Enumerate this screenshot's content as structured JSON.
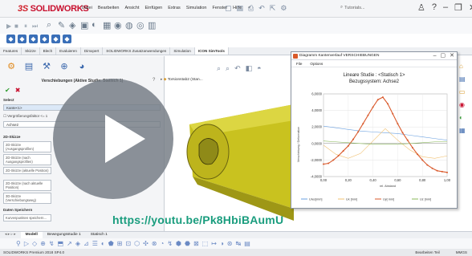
{
  "app": {
    "logo_ds": "3S",
    "logo_text": "SOLIDWORKS",
    "menus": [
      "Datei",
      "Bearbeiten",
      "Ansicht",
      "Einfügen",
      "Extras",
      "Simulation",
      "Fenster",
      "Hilfe"
    ],
    "search_label": "Tutorials...",
    "help_label": "?"
  },
  "tabs": [
    "Features",
    "Skizze",
    "Blech",
    "Evaluieren",
    "Dimxpert",
    "SOLIDWORKS Zusatzanwendungen",
    "Simulation",
    "ICON SimTools"
  ],
  "active_tab_index": 7,
  "panel": {
    "title": "Verschiebungen (Aktive Studie: Statisch 1)",
    "help": "?",
    "select_label": "Select",
    "select_value": "Kante<1>",
    "compare_label": "Vergrößerungsfaktor <= 1",
    "compare_value": "Achse2",
    "sketch_label": "2D-Skizze",
    "btn_1": "2D-Skizze (Ausgangsprofilen)",
    "btn_2": "2D-Skizze (nach Ausgangsprofilen)",
    "btn_3": "2D-Skizze (aktuelle Position)",
    "btn_4": "2D-Skizze (nach aktuelle Position)",
    "btn_5": "3D-Skizze (Verschiebungsweg)",
    "data_label": "Daten Speichern",
    "btn_6": "Kurvenpunkten speichern..."
  },
  "tree": {
    "label": "Torsionstab2 (Stan..."
  },
  "diagram": {
    "window_title": "Diagramm Kantenverlauf VERSCHIEBUNGEN",
    "menu_file": "File",
    "menu_options": "Options",
    "chart_title": "Lineare Studie : <Statisch 1>",
    "chart_subtitle": "Bezugssystem: Achse2",
    "ylabel": "Verschiebung / Deformation",
    "xlabel": "rel. Abstand",
    "legend": [
      "Ures[mm]",
      "Ux [mm]",
      "Uy[ mm]",
      "Uz [mm]"
    ]
  },
  "chart_data": {
    "type": "line",
    "title": "Lineare Studie : <Statisch 1>",
    "subtitle": "Bezugssystem: Achse2",
    "xlabel": "rel. Abstand",
    "ylabel": "Verschiebung / Deformation",
    "xlim": [
      0,
      1
    ],
    "ylim": [
      -4,
      6
    ],
    "xticks": [
      "0,00",
      "0,20",
      "0,40",
      "0,60",
      "0,80",
      "1,00"
    ],
    "yticks": [
      "-4,0000",
      "-2,0000",
      "0,0000",
      "2,0000",
      "4,0000",
      "6,0000"
    ],
    "grid": true,
    "legend_position": "bottom",
    "series": [
      {
        "name": "Ures[mm]",
        "color": "#6aa0e0",
        "x": [
          0,
          0.1,
          0.2,
          0.3,
          0.4,
          0.5,
          0.6,
          0.7,
          0.8,
          0.9,
          1.0
        ],
        "y": [
          2.1,
          1.9,
          1.7,
          1.5,
          1.4,
          1.3,
          1.2,
          1.0,
          0.8,
          0.6,
          0.4
        ]
      },
      {
        "name": "Ux [mm]",
        "color": "#f0c070",
        "x": [
          0,
          0.1,
          0.2,
          0.3,
          0.4,
          0.5,
          0.6,
          0.7,
          0.8,
          0.9,
          1.0
        ],
        "y": [
          -0.2,
          -1.3,
          -1.8,
          -1.2,
          0.3,
          1.8,
          0.4,
          -0.8,
          -1.6,
          -1.8,
          -1.5
        ]
      },
      {
        "name": "Uy[ mm]",
        "color": "#d9592b",
        "x": [
          0,
          0.04,
          0.08,
          0.12,
          0.16,
          0.2,
          0.24,
          0.28,
          0.32,
          0.36,
          0.4,
          0.44,
          0.48,
          0.52,
          0.56,
          0.6,
          0.64,
          0.68,
          0.72,
          0.76,
          0.8,
          0.84,
          0.88,
          0.92,
          0.96,
          1.0
        ],
        "y": [
          -2.5,
          -2.4,
          -2.0,
          -1.5,
          -0.9,
          -0.3,
          0.5,
          1.4,
          2.4,
          3.4,
          4.4,
          5.3,
          5.6,
          4.8,
          3.6,
          2.4,
          1.3,
          0.4,
          -0.5,
          -1.3,
          -2.0,
          -2.6,
          -3.0,
          -3.3,
          -3.4,
          -3.5
        ]
      },
      {
        "name": "Uz [mm]",
        "color": "#8ab85a",
        "x": [
          0,
          0.1,
          0.2,
          0.3,
          0.4,
          0.5,
          0.6,
          0.7,
          0.8,
          0.9,
          1.0
        ],
        "y": [
          0.3,
          0.2,
          0.1,
          0.0,
          -0.1,
          -0.1,
          -0.1,
          0.0,
          0.1,
          0.2,
          0.2
        ]
      }
    ]
  },
  "bottom_tabs": [
    "Modell",
    "Bewegungsstudie 1",
    "Statisch 1"
  ],
  "status": {
    "left": "SOLIDWORKS Premium 2018 SP4.0",
    "edit": "Bearbeiten Teil",
    "units": "MMGS"
  },
  "overlay": {
    "url": "https://youtu.be/Pk8HbiBAumU"
  }
}
